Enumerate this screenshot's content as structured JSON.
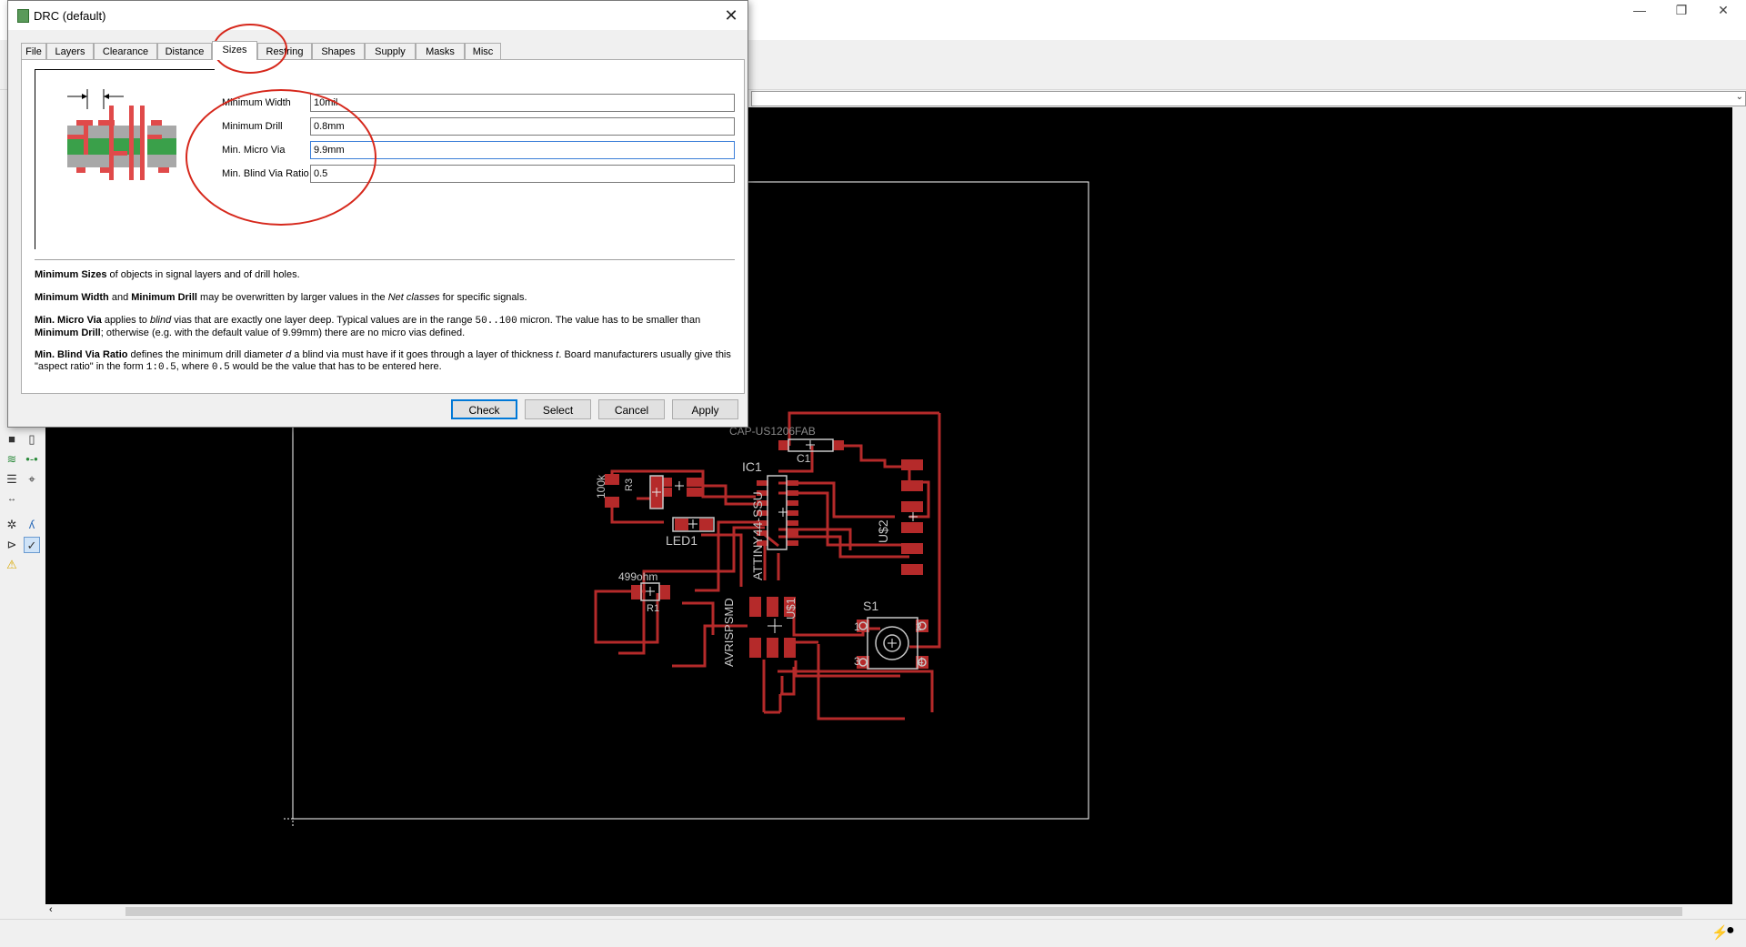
{
  "colors": {
    "canvas": "#000000",
    "copper": "#b52a2a",
    "silk": "#c8c8c8",
    "outline": "#ffffff",
    "annotation": "#d6281c"
  },
  "window_controls": {
    "minimize": "—",
    "restore": "❐",
    "close": "✕"
  },
  "command_line": {
    "value": ""
  },
  "dialog": {
    "title": "DRC (default)",
    "close_glyph": "✕",
    "tabs": [
      {
        "label": "File"
      },
      {
        "label": "Layers"
      },
      {
        "label": "Clearance"
      },
      {
        "label": "Distance"
      },
      {
        "label": "Sizes"
      },
      {
        "label": "Restring"
      },
      {
        "label": "Shapes"
      },
      {
        "label": "Supply"
      },
      {
        "label": "Masks"
      },
      {
        "label": "Misc"
      }
    ],
    "active_tab": "Sizes",
    "fields": {
      "min_width": {
        "label": "Minimum Width",
        "value": "10mil"
      },
      "min_drill": {
        "label": "Minimum Drill",
        "value": "0.8mm"
      },
      "min_micro_via": {
        "label": "Min. Micro Via",
        "value": "9.9mm"
      },
      "min_blind_ratio": {
        "label": "Min. Blind Via Ratio",
        "value": "0.5"
      }
    },
    "help": {
      "p1_b1": "Minimum Sizes",
      "p1_t1": " of objects in signal layers and of drill holes.",
      "p2_b1": "Minimum Width",
      "p2_t1": " and ",
      "p2_b2": "Minimum Drill",
      "p2_t2": " may be overwritten by larger values in the ",
      "p2_i1": "Net classes",
      "p2_t3": " for specific signals.",
      "p3_b1": "Min. Micro Via",
      "p3_t1": " applies to ",
      "p3_i1": "blind",
      "p3_t2": " vias that are exactly one layer deep. Typical values are in the range ",
      "p3_m1": "50..100",
      "p3_t3": " micron. The value has to be smaller than",
      "p3_b2": "Minimum Drill",
      "p3_t4": "; otherwise (e.g. with the default value of 9.99mm) there are no micro vias defined.",
      "p4_b1": "Min. Blind Via Ratio",
      "p4_t1": " defines the minimum drill diameter ",
      "p4_i1": "d",
      "p4_t2": " a blind via must have if it goes through a layer of thickness ",
      "p4_i2": "t",
      "p4_t3": ". Board manufacturers usually give this",
      "p4_t4": "\"aspect ratio\" in the form ",
      "p4_m1": "1:0.5",
      "p4_t5": ", where ",
      "p4_m2": "0.5",
      "p4_t6": " would be the value that has to be entered here."
    },
    "buttons": {
      "check": "Check",
      "select": "Select",
      "cancel": "Cancel",
      "apply": "Apply"
    }
  },
  "board_labels": {
    "c1_name": "CAP-US1206FAB",
    "c1": "C1",
    "ic1": "IC1",
    "ic1_value": "ATTINY44-SSU",
    "r3_value": "100k",
    "r3": "R3",
    "led1": "LED1",
    "r1_value": "499ohm",
    "r1": "R1",
    "u2": "U$2",
    "u1": "U$1",
    "isp": "AVRISPSMD",
    "s1": "S1",
    "s1_p1": "1",
    "s1_p2": "2",
    "s1_p3": "3",
    "s1_p4": "4"
  }
}
